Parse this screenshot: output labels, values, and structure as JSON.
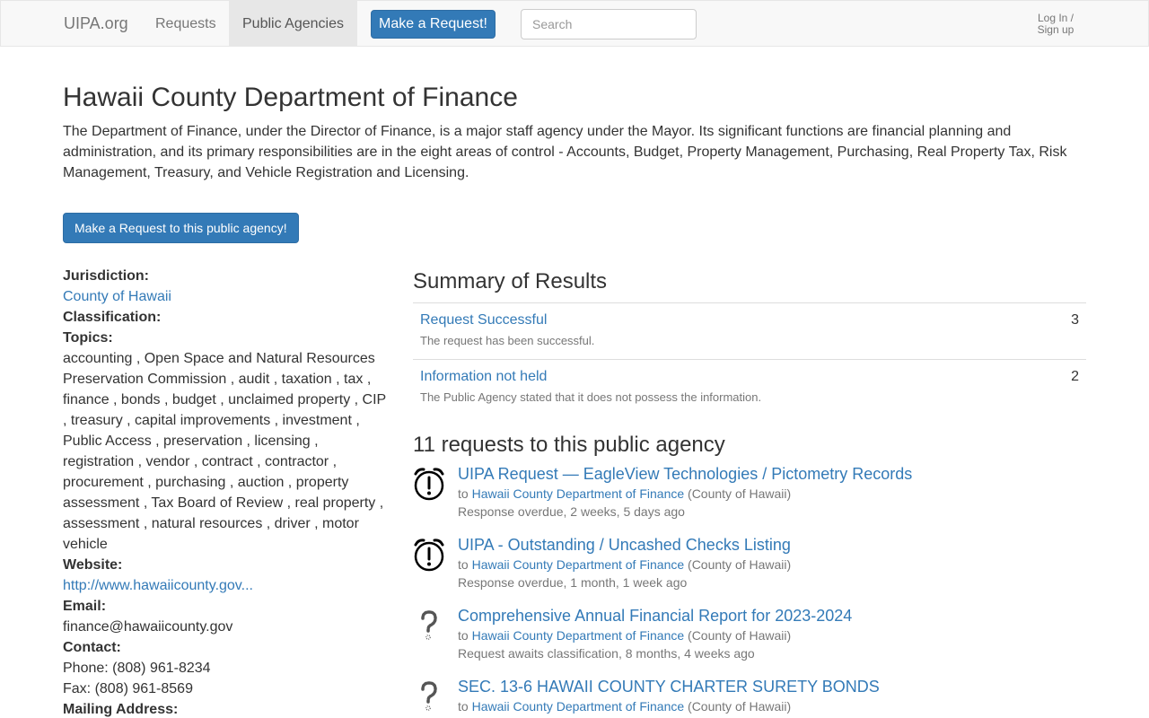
{
  "nav": {
    "brand": "UIPA.org",
    "requests": "Requests",
    "public_agencies": "Public Agencies",
    "make_request": "Make a Request!",
    "search_placeholder": "Search",
    "login_line1": "Log In /",
    "login_line2": "Sign up"
  },
  "agency": {
    "name": "Hawaii County Department of Finance",
    "description": "The Department of Finance, under the Director of Finance, is a major staff agency under the Mayor. Its significant functions are financial planning and administration, and its primary responsibilities are in the eight areas of control - Accounts, Budget, Property Management, Purchasing, Real Property Tax, Risk Management, Treasury, and Vehicle Registration and Licensing.",
    "request_button": "Make a Request to this public agency!"
  },
  "sidebar": {
    "jurisdiction_label": "Jurisdiction:",
    "jurisdiction_value": "County of Hawaii",
    "classification_label": "Classification:",
    "topics_label": "Topics:",
    "topics": "accounting , Open Space and Natural Resources Preservation Commission , audit , taxation , tax , finance , bonds , budget , unclaimed property , CIP , treasury , capital improvements , investment , Public Access , preservation , licensing , registration , vendor , contract , contractor , procurement , purchasing , auction , property assessment , Tax Board of Review , real property , assessment , natural resources , driver , motor vehicle",
    "website_label": "Website:",
    "website_value": "http://www.hawaiicounty.gov...",
    "email_label": "Email:",
    "email_value": "finance@hawaiicounty.gov",
    "contact_label": "Contact:",
    "phone": "Phone: (808) 961-8234",
    "fax": "Fax: (808) 961-8569",
    "mailing_label": "Mailing Address:"
  },
  "summary": {
    "title": "Summary of Results",
    "rows": [
      {
        "title": "Request Successful",
        "desc": "The request has been successful.",
        "count": "3"
      },
      {
        "title": "Information not held",
        "desc": "The Public Agency stated that it does not possess the information.",
        "count": "2"
      }
    ]
  },
  "requests": {
    "title": "11 requests to this public agency",
    "items": [
      {
        "title": "UIPA Request — EagleView Technologies / Pictometry Records",
        "to_prefix": "to",
        "agency": "Hawaii County Department of Finance",
        "jurisdiction": "(County of Hawaii)",
        "status": "Response overdue, 2 weeks, 5 days ago",
        "icon": "alarm-clock-icon"
      },
      {
        "title": "UIPA - Outstanding / Uncashed Checks Listing",
        "to_prefix": "to",
        "agency": "Hawaii County Department of Finance",
        "jurisdiction": "(County of Hawaii)",
        "status": "Response overdue, 1 month, 1 week ago",
        "icon": "alarm-clock-icon"
      },
      {
        "title": "Comprehensive Annual Financial Report for 2023-2024",
        "to_prefix": "to",
        "agency": "Hawaii County Department of Finance",
        "jurisdiction": "(County of Hawaii)",
        "status": "Request awaits classification, 8 months, 4 weeks ago",
        "icon": "question-mark-icon"
      },
      {
        "title": "SEC. 13-6 HAWAII COUNTY CHARTER SURETY BONDS",
        "to_prefix": "to",
        "agency": "Hawaii County Department of Finance",
        "jurisdiction": "(County of Hawaii)",
        "status": "",
        "icon": "question-mark-icon"
      }
    ]
  },
  "colors": {
    "link": "#337ab7",
    "primary_button": "#337ab7",
    "muted": "#777777"
  }
}
